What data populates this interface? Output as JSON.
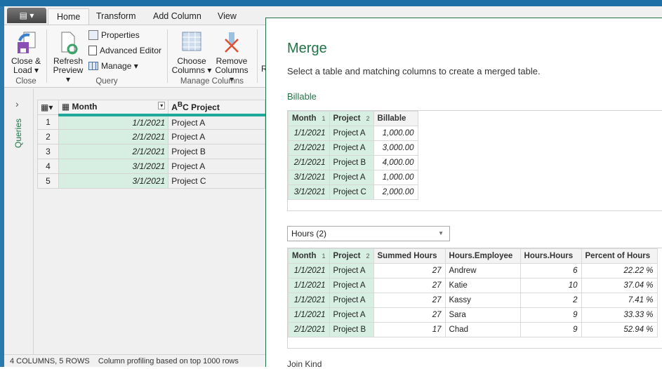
{
  "ribbon": {
    "file_label": "▤ ▾",
    "tabs": [
      "Home",
      "Transform",
      "Add Column",
      "View"
    ],
    "close_load": [
      "Close &",
      "Load ▾"
    ],
    "refresh": [
      "Refresh",
      "Preview ▾"
    ],
    "properties": "Properties",
    "advanced_editor": "Advanced Editor",
    "manage": "Manage ▾",
    "choose": [
      "Choose",
      "Columns ▾"
    ],
    "remove": [
      "Remove",
      "Columns ▾"
    ],
    "cut_label": "R",
    "groups": [
      "Close",
      "Query",
      "Manage Columns"
    ]
  },
  "queries_label": "Queries",
  "grid": {
    "columns": [
      "Month",
      "Project"
    ],
    "rows": [
      [
        "1",
        "1/1/2021",
        "Project A"
      ],
      [
        "2",
        "2/1/2021",
        "Project A"
      ],
      [
        "3",
        "2/1/2021",
        "Project B"
      ],
      [
        "4",
        "3/1/2021",
        "Project A"
      ],
      [
        "5",
        "3/1/2021",
        "Project C"
      ]
    ]
  },
  "status": {
    "summary": "4 COLUMNS, 5 ROWS",
    "profiling": "Column profiling based on top 1000 rows"
  },
  "dialog": {
    "title": "Merge",
    "subtitle": "Select a table and matching columns to create a merged table.",
    "first_table": "Billable",
    "table1": {
      "columns": [
        "Month",
        "Project",
        "Billable"
      ],
      "badges": [
        "1",
        "2"
      ],
      "rows": [
        [
          "1/1/2021",
          "Project A",
          "1,000.00"
        ],
        [
          "2/1/2021",
          "Project A",
          "3,000.00"
        ],
        [
          "2/1/2021",
          "Project B",
          "4,000.00"
        ],
        [
          "3/1/2021",
          "Project A",
          "1,000.00"
        ],
        [
          "3/1/2021",
          "Project C",
          "2,000.00"
        ]
      ]
    },
    "second_table_select": "Hours (2)",
    "table2": {
      "columns": [
        "Month",
        "Project",
        "Summed Hours",
        "Hours.Employee",
        "Hours.Hours",
        "Percent of Hours"
      ],
      "badges": [
        "1",
        "2"
      ],
      "rows": [
        [
          "1/1/2021",
          "Project A",
          "27",
          "Andrew",
          "6",
          "22.22 %"
        ],
        [
          "1/1/2021",
          "Project A",
          "27",
          "Katie",
          "10",
          "37.04 %"
        ],
        [
          "1/1/2021",
          "Project A",
          "27",
          "Kassy",
          "2",
          "7.41 %"
        ],
        [
          "1/1/2021",
          "Project A",
          "27",
          "Sara",
          "9",
          "33.33 %"
        ],
        [
          "2/1/2021",
          "Project B",
          "17",
          "Chad",
          "9",
          "52.94 %"
        ]
      ]
    },
    "join_kind_label": "Join Kind"
  },
  "colors": {
    "accent": "#217346",
    "key_column": "#d6efe2",
    "header_teal": "#1fa99a"
  }
}
